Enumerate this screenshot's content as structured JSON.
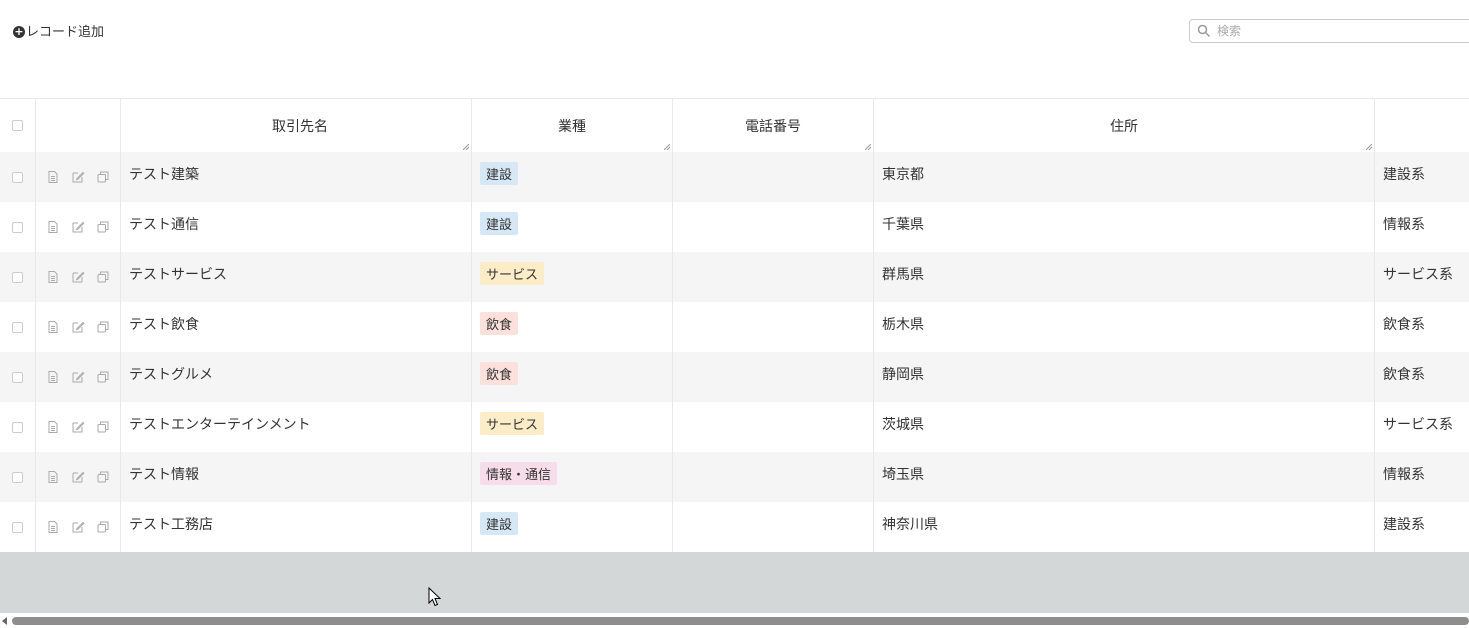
{
  "toolbar": {
    "add_label": "レコード追加",
    "search_placeholder": "検索"
  },
  "columns": {
    "name": "取引先名",
    "industry": "業種",
    "phone": "電話番号",
    "address": "住所"
  },
  "tag_colors": {
    "建設": "#d6e7f5",
    "サービス": "#fdecc8",
    "飲食": "#fbe0dc",
    "情報・通信": "#f7dde9"
  },
  "rows": [
    {
      "name": "テスト建築",
      "industry": "建設",
      "phone": "",
      "address": "東京都",
      "extra": "建設系"
    },
    {
      "name": "テスト通信",
      "industry": "建設",
      "phone": "",
      "address": "千葉県",
      "extra": "情報系"
    },
    {
      "name": "テストサービス",
      "industry": "サービス",
      "phone": "",
      "address": "群馬県",
      "extra": "サービス系"
    },
    {
      "name": "テスト飲食",
      "industry": "飲食",
      "phone": "",
      "address": "栃木県",
      "extra": "飲食系"
    },
    {
      "name": "テストグルメ",
      "industry": "飲食",
      "phone": "",
      "address": "静岡県",
      "extra": "飲食系"
    },
    {
      "name": "テストエンターテインメント",
      "industry": "サービス",
      "phone": "",
      "address": "茨城県",
      "extra": "サービス系"
    },
    {
      "name": "テスト情報",
      "industry": "情報・通信",
      "phone": "",
      "address": "埼玉県",
      "extra": "情報系"
    },
    {
      "name": "テスト工務店",
      "industry": "建設",
      "phone": "",
      "address": "神奈川県",
      "extra": "建設系"
    }
  ]
}
